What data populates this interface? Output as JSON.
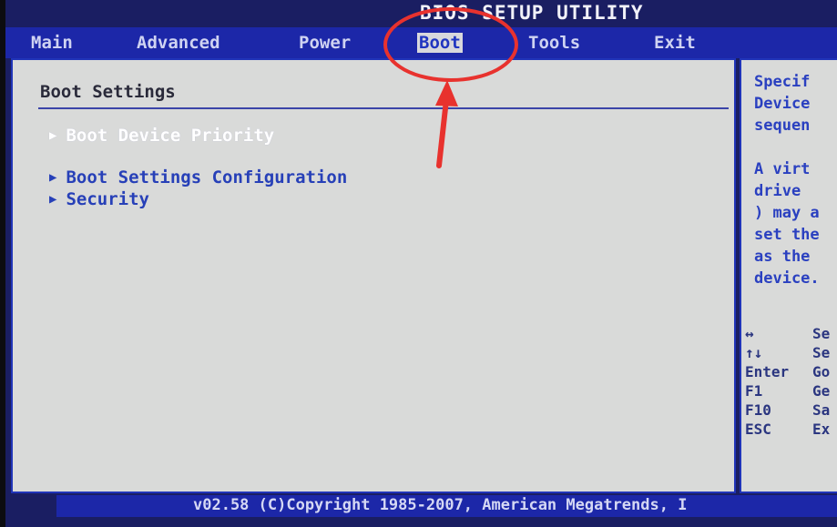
{
  "title": "BIOS SETUP UTILITY",
  "menu": [
    {
      "label": "Main"
    },
    {
      "label": "Advanced"
    },
    {
      "label": "Power"
    },
    {
      "label": "Boot"
    },
    {
      "label": "Tools"
    },
    {
      "label": "Exit"
    }
  ],
  "active_menu": "Boot",
  "panel": {
    "title": "Boot Settings",
    "entries": [
      {
        "label": "Boot Device Priority"
      },
      {
        "label": "Boot Settings Configuration"
      },
      {
        "label": "Security"
      }
    ]
  },
  "help": {
    "text": "Specif\nDevice\nsequen\n\nA virt\ndrive \n) may a\nset the\nas the\ndevice."
  },
  "keys": [
    {
      "key": "↔",
      "action": "Se"
    },
    {
      "key": "↑↓",
      "action": "Se"
    },
    {
      "key": "Enter",
      "action": "Go"
    },
    {
      "key": "F1",
      "action": "Ge"
    },
    {
      "key": "F10",
      "action": "Sa"
    },
    {
      "key": "ESC",
      "action": "Ex"
    }
  ],
  "footer": "v02.58 (C)Copyright 1985-2007, American Megatrends, I",
  "colors": {
    "menubar": "#1c27a8",
    "panel": "#d9dad9",
    "highlight_annotation": "#e8322e"
  }
}
